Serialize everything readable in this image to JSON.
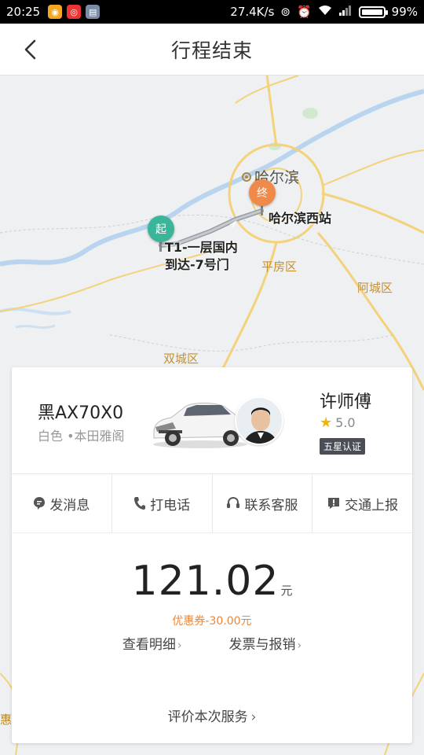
{
  "status_bar": {
    "time": "20:25",
    "network_speed": "27.4K/s",
    "battery": "99%",
    "icons": [
      "app-icon-1",
      "app-icon-2",
      "app-icon-3",
      "sync-icon",
      "alarm-icon",
      "wifi-icon",
      "signal-icon",
      "battery-icon"
    ]
  },
  "header": {
    "title": "行程结束",
    "back_icon": "chevron-left-icon"
  },
  "map": {
    "city": "哈尔滨",
    "districts": [
      "平房区",
      "阿城区",
      "双城区"
    ],
    "edge_label": "惠市",
    "start": {
      "pin": "起",
      "label_line1": "T1-一层国内",
      "label_line2": "到达-7号门",
      "color": "#3bb59a"
    },
    "end": {
      "pin": "终",
      "label": "哈尔滨西站",
      "color": "#f08a4b"
    }
  },
  "driver_card": {
    "plate": "黑AX70X0",
    "car_desc": "白色 •本田雅阁",
    "driver_name": "许师傅",
    "rating": "5.0",
    "badge": "五星认证"
  },
  "actions": [
    {
      "label": "发消息",
      "icon": "message-icon"
    },
    {
      "label": "打电话",
      "icon": "phone-icon"
    },
    {
      "label": "联系客服",
      "icon": "headset-icon"
    },
    {
      "label": "交通上报",
      "icon": "report-icon"
    }
  ],
  "fare": {
    "amount": "121.02",
    "unit": "元",
    "coupon": "优惠券-30.00元",
    "details_link": "查看明细",
    "invoice_link": "发票与报销",
    "review_link": "评价本次服务"
  },
  "colors": {
    "accent_orange": "#e8873b",
    "start_green": "#3bb59a",
    "end_orange": "#f08a4b",
    "star": "#f5b400"
  }
}
